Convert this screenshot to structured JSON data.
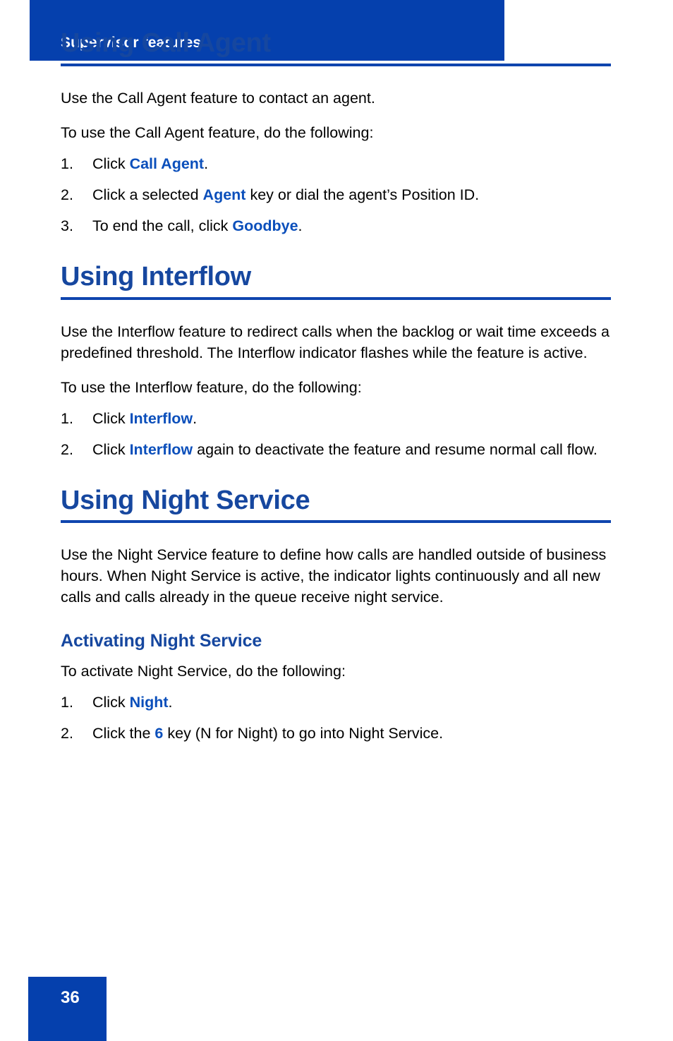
{
  "header": {
    "running_title": "Supervisor features",
    "band_color": "#0540ad"
  },
  "footer": {
    "page_number": "36",
    "band_color": "#0540ad"
  },
  "theme": {
    "heading_color": "#16479f",
    "rule_color": "#0f45ae",
    "keyword_color": "#0b4fbb",
    "body_color": "#000000"
  },
  "sections": {
    "call_agent": {
      "heading": "Using Call Agent",
      "intro": "Use the Call Agent feature to contact an agent.",
      "lead_in": "To use the Call Agent feature, do the following:",
      "steps": [
        {
          "num": "1.",
          "pre": "Click ",
          "kw": "Call Agent",
          "post": "."
        },
        {
          "num": "2.",
          "pre": "Click a selected ",
          "kw": "Agent",
          "post": " key or dial the agent’s Position ID."
        },
        {
          "num": "3.",
          "pre": "To end the call, click ",
          "kw": "Goodbye",
          "post": "."
        }
      ]
    },
    "interflow": {
      "heading": "Using Interflow",
      "intro": "Use the Interflow feature to redirect calls when the backlog or wait time exceeds a predefined threshold. The Interflow indicator flashes while the feature is active.",
      "lead_in": "To use the Interflow feature, do the following:",
      "steps": [
        {
          "num": "1.",
          "pre": "Click ",
          "kw": "Interflow",
          "post": "."
        },
        {
          "num": "2.",
          "pre": "Click ",
          "kw": "Interflow",
          "post": " again to deactivate the feature and resume normal call flow."
        }
      ]
    },
    "night_service": {
      "heading": "Using Night Service",
      "intro": "Use the Night Service feature to define how calls are handled outside of business hours. When Night Service is active, the indicator lights continuously and all new calls and calls already in the queue receive night service.",
      "subsection": {
        "heading": "Activating Night Service",
        "lead_in": "To activate Night Service, do the following:",
        "steps": [
          {
            "num": "1.",
            "pre": "Click ",
            "kw": "Night",
            "post": "."
          },
          {
            "num": "2.",
            "pre": "Click the ",
            "kw": "6",
            "post": " key (N for Night) to go into Night Service."
          }
        ]
      }
    }
  }
}
